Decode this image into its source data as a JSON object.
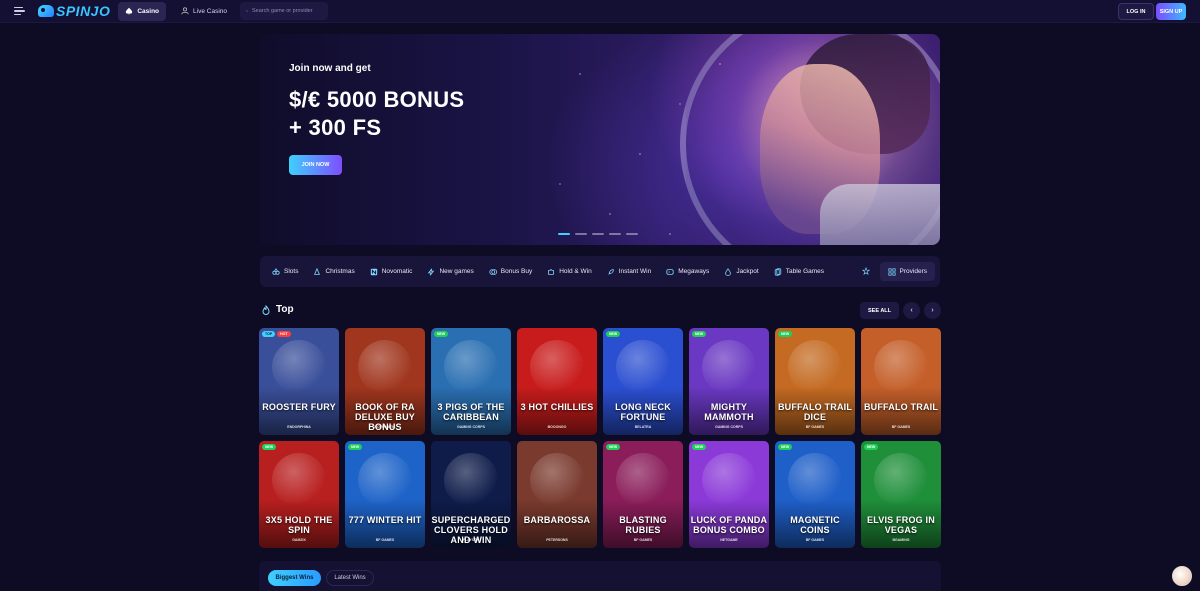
{
  "header": {
    "logo_text": "SPINJO",
    "tabs": [
      {
        "label": "Casino",
        "active": true
      },
      {
        "label": "Live Casino",
        "active": false
      }
    ],
    "search_placeholder": "Search game or provider",
    "login_label": "LOG IN",
    "signup_label": "SIGN UP"
  },
  "hero": {
    "pre_title": "Join now and get",
    "title_line1": "$/€ 5000 BONUS",
    "title_line2": "+ 300 FS",
    "cta_label": "JOIN NOW",
    "slide_count": 5,
    "active_slide": 1
  },
  "categories": [
    {
      "label": "Slots",
      "icon": "slots-icon"
    },
    {
      "label": "Christmas",
      "icon": "tree-icon"
    },
    {
      "label": "Novomatic",
      "icon": "n-icon"
    },
    {
      "label": "New games",
      "icon": "bolt-icon"
    },
    {
      "label": "Bonus Buy",
      "icon": "coins-icon"
    },
    {
      "label": "Hold & Win",
      "icon": "puzzle-icon"
    },
    {
      "label": "Instant Win",
      "icon": "rocket-icon"
    },
    {
      "label": "Megaways",
      "icon": "gamepad-icon"
    },
    {
      "label": "Jackpot",
      "icon": "jackpot-icon"
    },
    {
      "label": "Table Games",
      "icon": "cards-icon"
    }
  ],
  "providers_label": "Providers",
  "top_section": {
    "title": "Top",
    "see_all_label": "SEE ALL",
    "prev_label": "‹",
    "next_label": "›"
  },
  "games": [
    {
      "name": "ROOSTER FURY",
      "provider": "ENDORPHINA",
      "badges": [
        "TOP",
        "HOT"
      ],
      "color": "#3a4f9a"
    },
    {
      "name": "BOOK OF RA DELUXE BUY BONUS",
      "provider": "NOVOMATIC",
      "badges": [],
      "color": "#a0361e"
    },
    {
      "name": "3 PIGS OF THE CARIBBEAN",
      "provider": "GAMING CORPS",
      "badges": [
        "NEW"
      ],
      "color": "#2a6fb2"
    },
    {
      "name": "3 HOT CHILLIES",
      "provider": "BOOONGO",
      "badges": [],
      "color": "#c81c1c"
    },
    {
      "name": "LONG NECK FORTUNE",
      "provider": "BELATRA",
      "badges": [
        "NEW"
      ],
      "color": "#2b4fd1"
    },
    {
      "name": "MIGHTY MAMMOTH",
      "provider": "GAMING CORPS",
      "badges": [
        "NEW"
      ],
      "color": "#6a38c2"
    },
    {
      "name": "BUFFALO TRAIL DICE",
      "provider": "BF GAMES",
      "badges": [
        "NEW"
      ],
      "color": "#c46a22"
    },
    {
      "name": "BUFFALO TRAIL",
      "provider": "BF GAMES",
      "badges": [],
      "color": "#c45f2a"
    },
    {
      "name": "3X5 HOLD THE SPIN",
      "provider": "GAMZIX",
      "badges": [
        "NEW"
      ],
      "color": "#b81f1f"
    },
    {
      "name": "777 WINTER HIT",
      "provider": "BF GAMES",
      "badges": [
        "NEW"
      ],
      "color": "#1e63c8"
    },
    {
      "name": "SUPERCHARGED CLOVERS HOLD AND WIN",
      "provider": "PLAYSON",
      "badges": [],
      "color": "#0f1c4a"
    },
    {
      "name": "BARBAROSSA",
      "provider": "PETERSONS",
      "badges": [],
      "color": "#7a3a2e"
    },
    {
      "name": "BLASTING RUBIES",
      "provider": "BF GAMES",
      "badges": [
        "NEW"
      ],
      "color": "#8a1d5a"
    },
    {
      "name": "LUCK OF PANDA BONUS COMBO",
      "provider": "NETGAME",
      "badges": [
        "NEW"
      ],
      "color": "#8b3ad8"
    },
    {
      "name": "MAGNETIC COINS",
      "provider": "BF GAMES",
      "badges": [
        "NEW"
      ],
      "color": "#1f5fc8"
    },
    {
      "name": "ELVIS FROG IN VEGAS",
      "provider": "BGAMING",
      "badges": [
        "NEW"
      ],
      "color": "#1f8f3a"
    }
  ],
  "wins_tabs": {
    "biggest": "Biggest Wins",
    "latest": "Latest Wins"
  }
}
